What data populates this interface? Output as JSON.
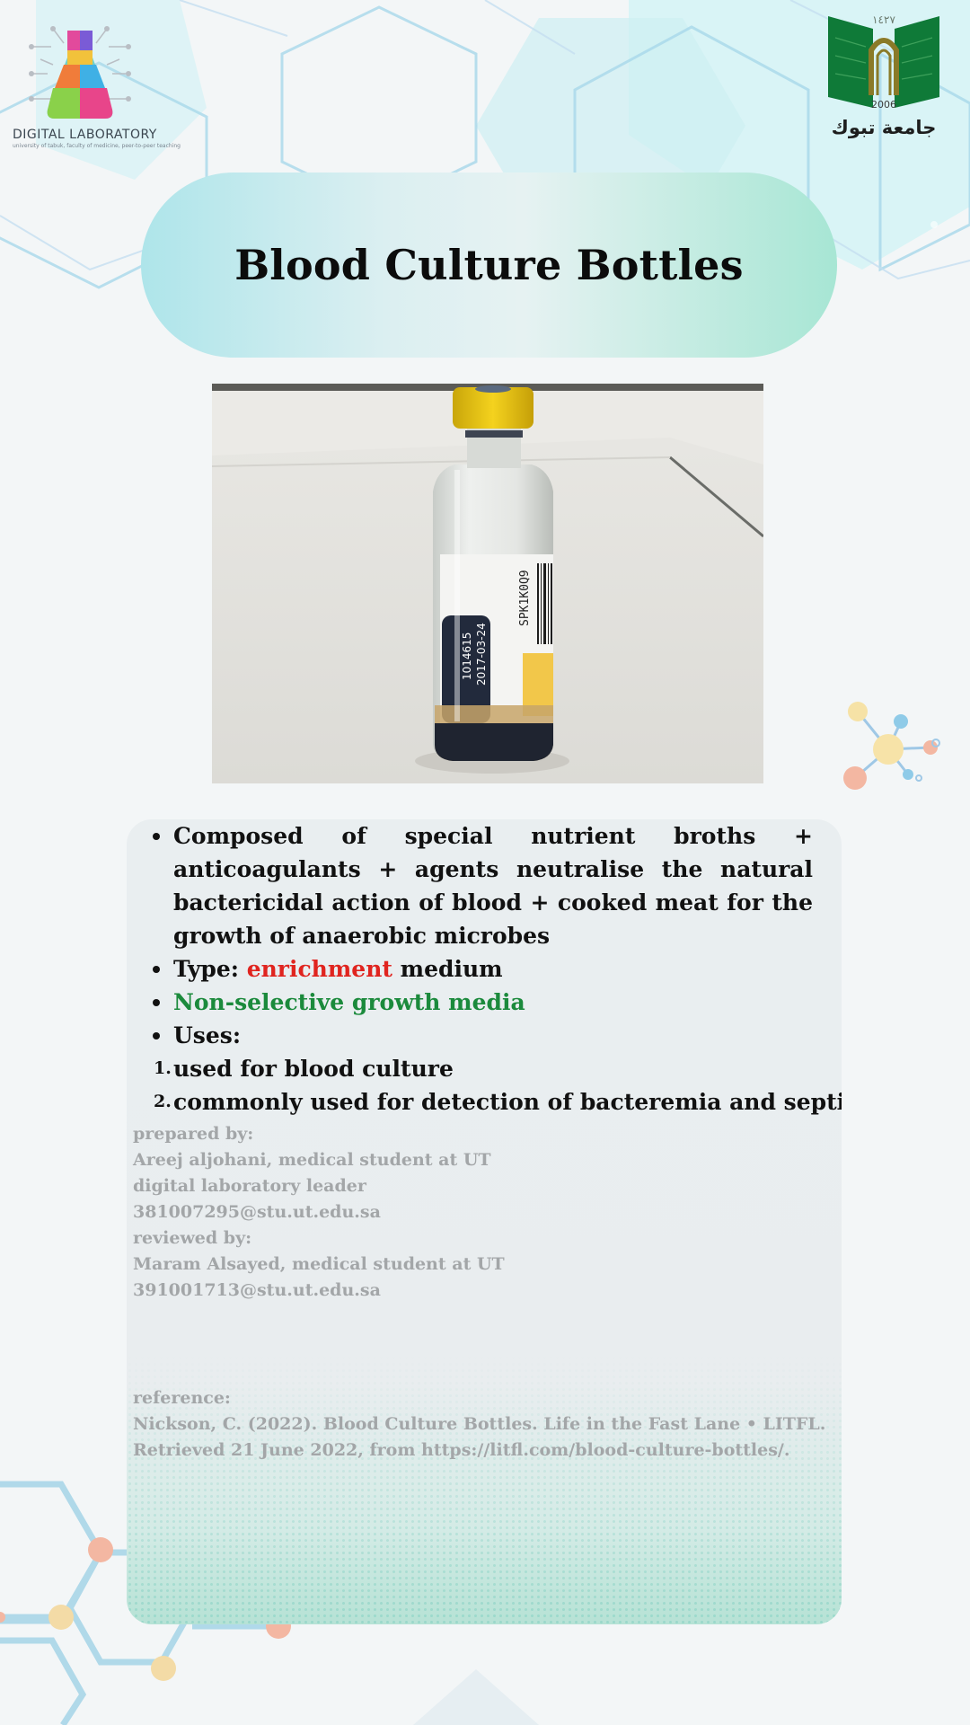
{
  "logos": {
    "left_text": "DIGITAL LABORATORY",
    "left_sub": "university of tabuk, faculty of medicine, peer-to-peer teaching",
    "right_year_arabic": "١٤٢٧",
    "right_year": "2006",
    "right_name": "جامعة تبوك"
  },
  "title": "Blood Culture Bottles",
  "photo": {
    "label_number": "1014615",
    "label_date": "2017-03-24",
    "barcode_text": "SPK1K0Q9"
  },
  "bullets": {
    "composed": "Composed of special nutrient broths + anticoagulants + agents neutralise the natural bactericidal action of blood + cooked meat for the growth of anaerobic microbes",
    "type_prefix": "Type: ",
    "type_value": "enrichment",
    "type_suffix": " medium",
    "selectivity": "Non-selective growth media",
    "uses_label": "Uses:",
    "uses": [
      {
        "num": "1.",
        "text": "used for blood culture"
      },
      {
        "num": "2.",
        "text": "commonly used for detection of bacteremia and septicemia"
      }
    ]
  },
  "credits": {
    "prepared_label": "prepared by:",
    "preparer": "Areej aljohani, medical student at UT",
    "preparer_role": "digital laboratory leader",
    "preparer_email": "381007295@stu.ut.edu.sa",
    "reviewed_label": "reviewed by:",
    "reviewer": "Maram Alsayed, medical student at UT",
    "reviewer_email": "391001713@stu.ut.edu.sa"
  },
  "reference": {
    "label": "reference:",
    "text": "Nickson, C. (2022). Blood Culture Bottles. Life in the Fast Lane • LITFL. Retrieved 21 June 2022, from https://litfl.com/blood-culture-bottles/."
  },
  "colors": {
    "highlight_red": "#e0241f",
    "highlight_green": "#1b8a3c",
    "university_green": "#0f7a38",
    "muted_text": "#a3a6a8"
  }
}
